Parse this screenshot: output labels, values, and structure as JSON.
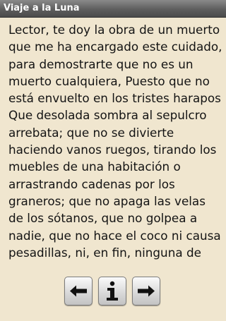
{
  "window": {
    "title": "Viaje a la Luna"
  },
  "page": {
    "lines": [
      "Lector, te doy la obra de un muerto",
      "que me ha encargado este cuidado,",
      "para demostrarte que no es un",
      "muerto cualquiera, Puesto que no",
      "está envuelto en los tristes harapos",
      "Que desolada sombra al sepulcro",
      "arrebata; que no se divierte",
      "haciendo vanos ruegos, tirando los",
      "muebles de una habitación o",
      "arrastrando cadenas por los",
      "graneros; que no apaga las velas",
      "de los sótanos, que no golpea a",
      "nadie, que no hace el coco ni causa",
      "pesadillas, ni, en fin, ninguna de"
    ]
  },
  "nav": {
    "prev_icon": "arrow-left-icon",
    "info_icon": "info-icon",
    "next_icon": "arrow-right-icon"
  }
}
